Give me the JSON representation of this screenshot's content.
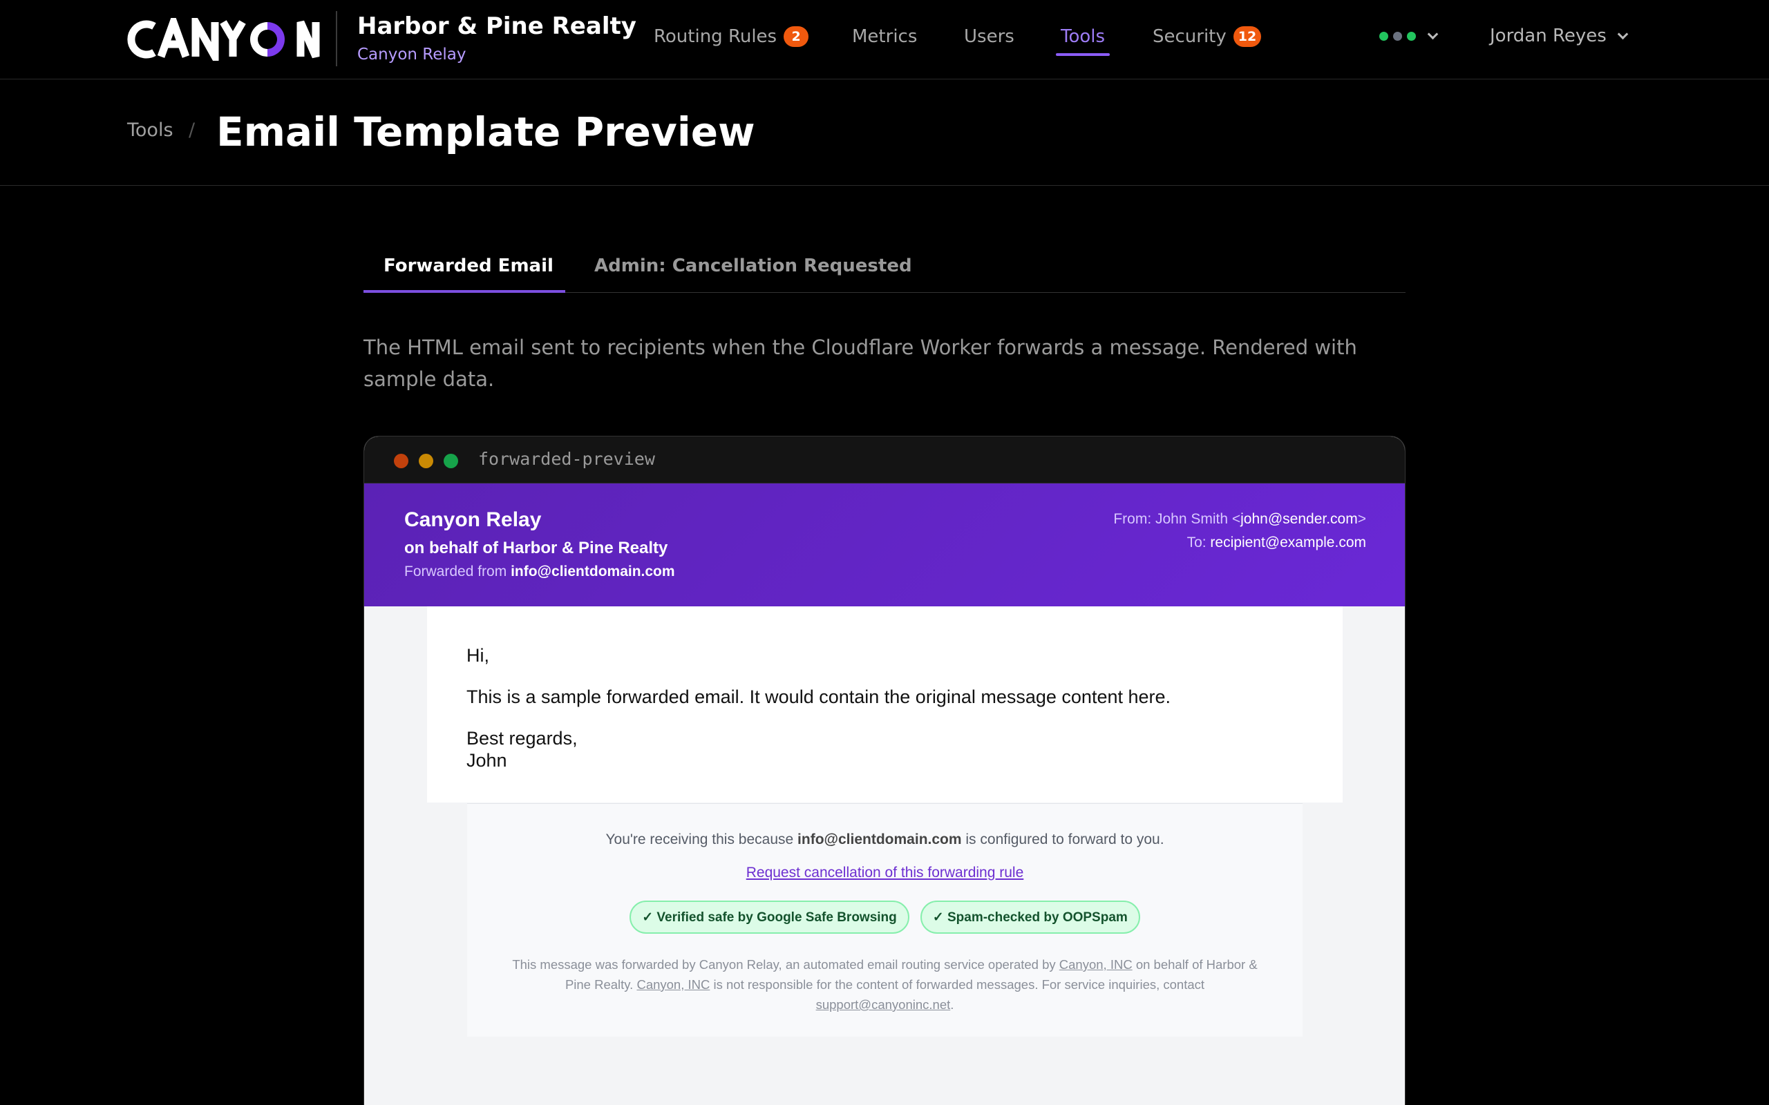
{
  "brand": {
    "logo_text": "CANYON",
    "name": "Harbor & Pine Realty",
    "product": "Canyon Relay"
  },
  "nav": {
    "items": [
      {
        "label": "Routing Rules",
        "badge": "2"
      },
      {
        "label": "Metrics"
      },
      {
        "label": "Users"
      },
      {
        "label": "Tools",
        "active": true
      },
      {
        "label": "Security",
        "badge": "12"
      }
    ],
    "status_colors": [
      "#22c55e",
      "#6b7280",
      "#22c55e"
    ],
    "user": "Jordan Reyes"
  },
  "header": {
    "breadcrumb": "Tools",
    "separator": "/",
    "title": "Email Template Preview"
  },
  "tabs": [
    {
      "label": "Forwarded Email",
      "active": true
    },
    {
      "label": "Admin: Cancellation Requested",
      "active": false
    }
  ],
  "description": "The HTML email sent to recipients when the Cloudflare Worker forwards a message. Rendered with sample data.",
  "preview": {
    "window_title": "forwarded-preview",
    "window_dot_colors": [
      "#c2410c",
      "#ca8a04",
      "#16a34a"
    ],
    "email_header": {
      "title": "Canyon Relay",
      "behalf": "on behalf of Harbor & Pine Realty",
      "forwarded_prefix": "Forwarded from",
      "forwarded_address": "info@clientdomain.com",
      "from_prefix": "From: John Smith <",
      "from_address": "john@sender.com",
      "from_suffix": ">",
      "to_prefix": "To:",
      "to_address": "recipient@example.com"
    },
    "email_body": {
      "greeting": "Hi,",
      "content": "This is a sample forwarded email. It would contain the original message content here.",
      "closing": "Best regards,",
      "signature": "John"
    },
    "footer": {
      "reason_prefix": "You're receiving this because",
      "reason_address": "info@clientdomain.com",
      "reason_suffix": "is configured to forward to you.",
      "cancel_link": "Request cancellation of this forwarding rule",
      "badges": [
        "✓ Verified safe by Google Safe Browsing",
        "✓ Spam-checked by OOPSpam"
      ],
      "legal_1": "This message was forwarded by Canyon Relay, an automated email routing service operated by",
      "company": "Canyon, INC",
      "legal_2": "on behalf of Harbor & Pine Realty.",
      "legal_3": "is not responsible for the content of forwarded messages. For service inquiries, contact",
      "support_email": "support@canyoninc.net",
      "legal_end": "."
    }
  },
  "colors": {
    "accent": "#8b5cf6",
    "badge": "#f0590e",
    "email_header": "#6a28d6"
  }
}
